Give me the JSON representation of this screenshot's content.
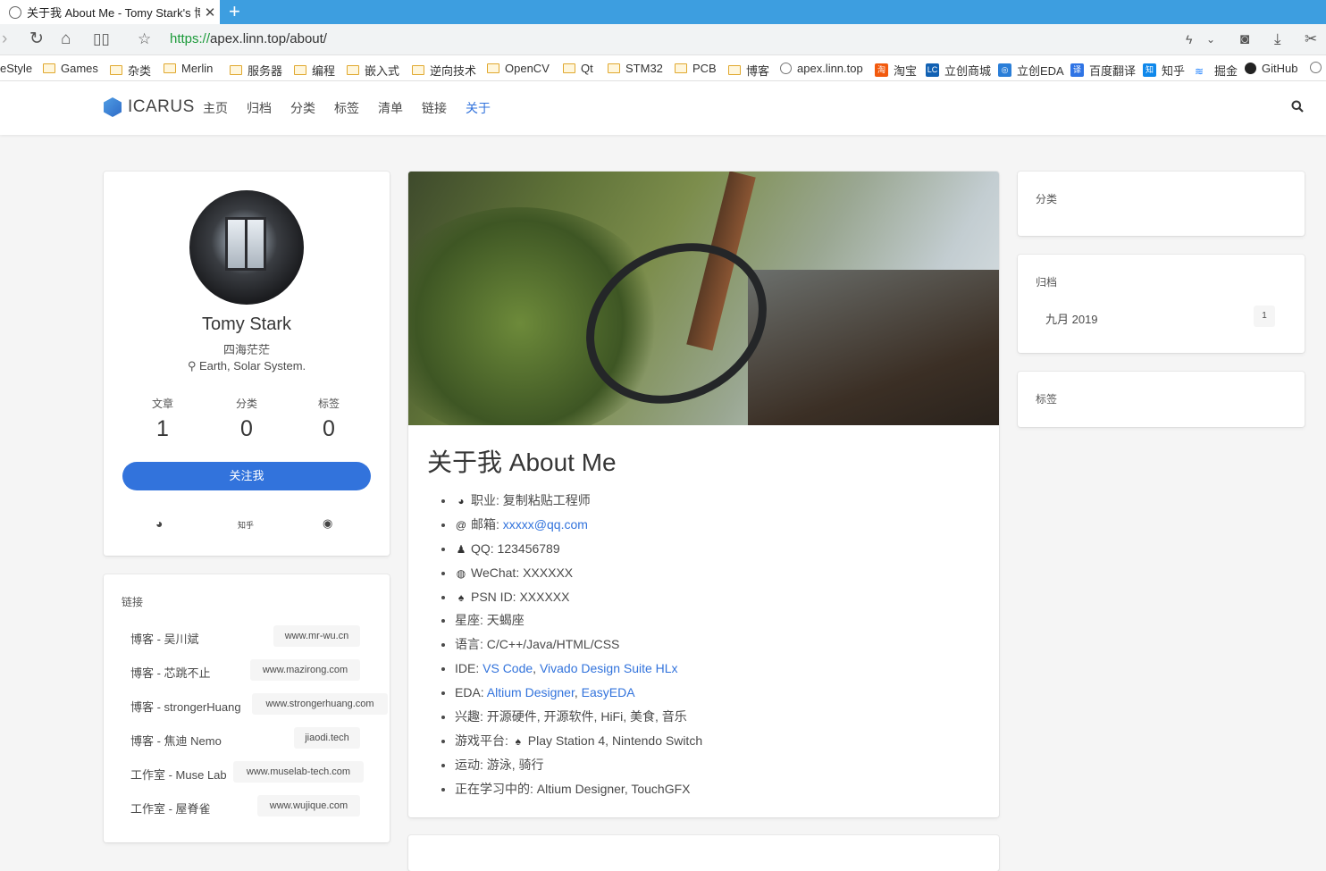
{
  "browser": {
    "tab_title": "关于我 About Me - Tomy Stark's 博客",
    "url_scheme": "https://",
    "url_rest": "apex.linn.top/about/",
    "bookmarks": [
      "eStyle",
      "Games",
      "杂类",
      "Merlin",
      "服务器",
      "编程",
      "嵌入式",
      "逆向技术",
      "OpenCV",
      "Qt",
      "STM32",
      "PCB",
      "博客",
      "apex.linn.top",
      "淘宝",
      "立创商城",
      "立创EDA",
      "百度翻译",
      "知乎",
      "掘金",
      "GitHub"
    ]
  },
  "site": {
    "logo_text": "ICARUS",
    "menu": [
      "主页",
      "归档",
      "分类",
      "标签",
      "清单",
      "链接",
      "关于"
    ],
    "active_menu": "关于"
  },
  "profile": {
    "name": "Tomy Stark",
    "description": "四海茫茫",
    "location": "Earth, Solar System.",
    "stats": [
      {
        "label": "文章",
        "value": "1"
      },
      {
        "label": "分类",
        "value": "0"
      },
      {
        "label": "标签",
        "value": "0"
      }
    ],
    "follow_label": "关注我",
    "social": {
      "zhihu": "知乎"
    }
  },
  "links_widget": {
    "title": "链接",
    "items": [
      {
        "name": "博客 - 吴川斌",
        "url": "www.mr-wu.cn"
      },
      {
        "name": "博客 - 芯跳不止",
        "url": "www.mazirong.com"
      },
      {
        "name": "博客 - strongerHuang",
        "url": "www.strongerhuang.com"
      },
      {
        "name": "博客 - 焦迪 Nemo",
        "url": "jiaodi.tech"
      },
      {
        "name": "工作室 - Muse Lab",
        "url": "www.muselab-tech.com"
      },
      {
        "name": "工作室 - 屋脊雀",
        "url": "www.wujique.com"
      }
    ]
  },
  "article": {
    "title": "关于我 About Me",
    "items": {
      "job": "职业: 复制粘贴工程师",
      "email_label": "邮箱: ",
      "email": "xxxxx@qq.com",
      "qq": "QQ: 123456789",
      "wechat": "WeChat: XXXXXX",
      "psn": "PSN ID: XXXXXX",
      "zodiac": "星座: 天蝎座",
      "lang": "语言: C/C++/Java/HTML/CSS",
      "ide_label": "IDE: ",
      "ide_1": "VS Code",
      "ide_2": "Vivado Design Suite HLx",
      "eda_label": "EDA: ",
      "eda_1": "Altium Designer",
      "eda_2": "EasyEDA",
      "hobby": "兴趣: 开源硬件, 开源软件, HiFi, 美食, 音乐",
      "game_label": "游戏平台: ",
      "game": "Play Station 4, Nintendo Switch",
      "sport": "运动: 游泳, 骑行",
      "learning": "正在学习中的: Altium Designer, TouchGFX"
    },
    "sep": ", "
  },
  "sidebar_right": {
    "categories_title": "分类",
    "archives_title": "归档",
    "archive_item": "九月 2019",
    "archive_count": "1",
    "tags_title": "标签"
  }
}
